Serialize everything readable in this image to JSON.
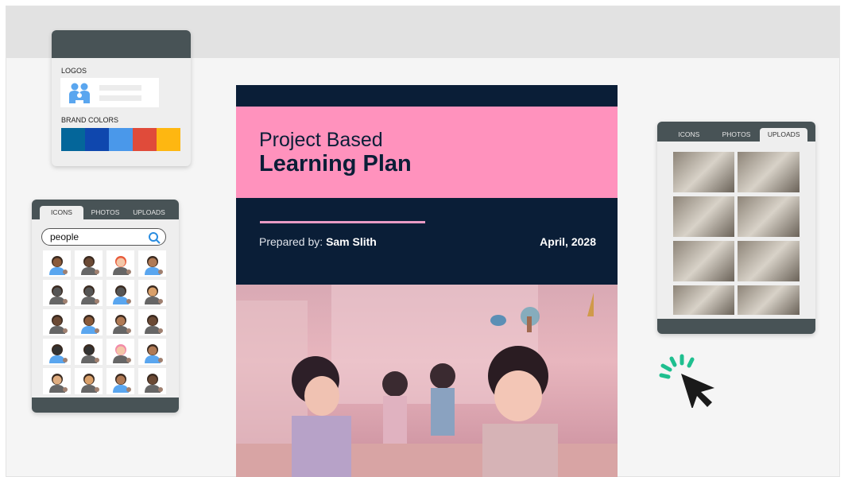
{
  "brand_panel": {
    "logos_label": "LOGOS",
    "brand_colors_label": "BRAND COLORS",
    "colors": [
      "#04669a",
      "#0f47ae",
      "#4a98ea",
      "#e04b3a",
      "#feb711"
    ]
  },
  "icons_panel": {
    "tabs": [
      {
        "label": "ICONS",
        "active": true
      },
      {
        "label": "PHOTOS",
        "active": false
      },
      {
        "label": "UPLOADS",
        "active": false
      }
    ],
    "search_value": "people",
    "search_icon": "search-icon",
    "icons": [
      "person-icon",
      "family-icon",
      "red-hair-woman-icon",
      "man-face-icon",
      "person-silhouette-icon",
      "person-silhouette-icon",
      "handshake-icon",
      "handshake-icon",
      "woman-standing-icon",
      "girl-standing-icon",
      "man-waving-icon",
      "man-standing-icon",
      "woman-dark-icon",
      "wheelchair-person-icon",
      "pink-hair-woman-icon",
      "woman-face-icon",
      "glasses-man-icon",
      "woman-face-icon",
      "bald-man-icon",
      "bearded-man-icon"
    ]
  },
  "document": {
    "title_line1": "Project Based",
    "title_line2": "Learning Plan",
    "prepared_label": "Prepared by:",
    "prepared_name": "Sam Slith",
    "date": "April, 2028",
    "colors": {
      "navy": "#0a1e37",
      "pink": "#ff92bd"
    }
  },
  "uploads_panel": {
    "tabs": [
      {
        "label": "ICONS",
        "active": false
      },
      {
        "label": "PHOTOS",
        "active": false
      },
      {
        "label": "UPLOADS",
        "active": true
      }
    ],
    "photo_count": 8
  },
  "cursor": {
    "icon": "click-cursor-icon",
    "accent": "#1fbf8f"
  }
}
